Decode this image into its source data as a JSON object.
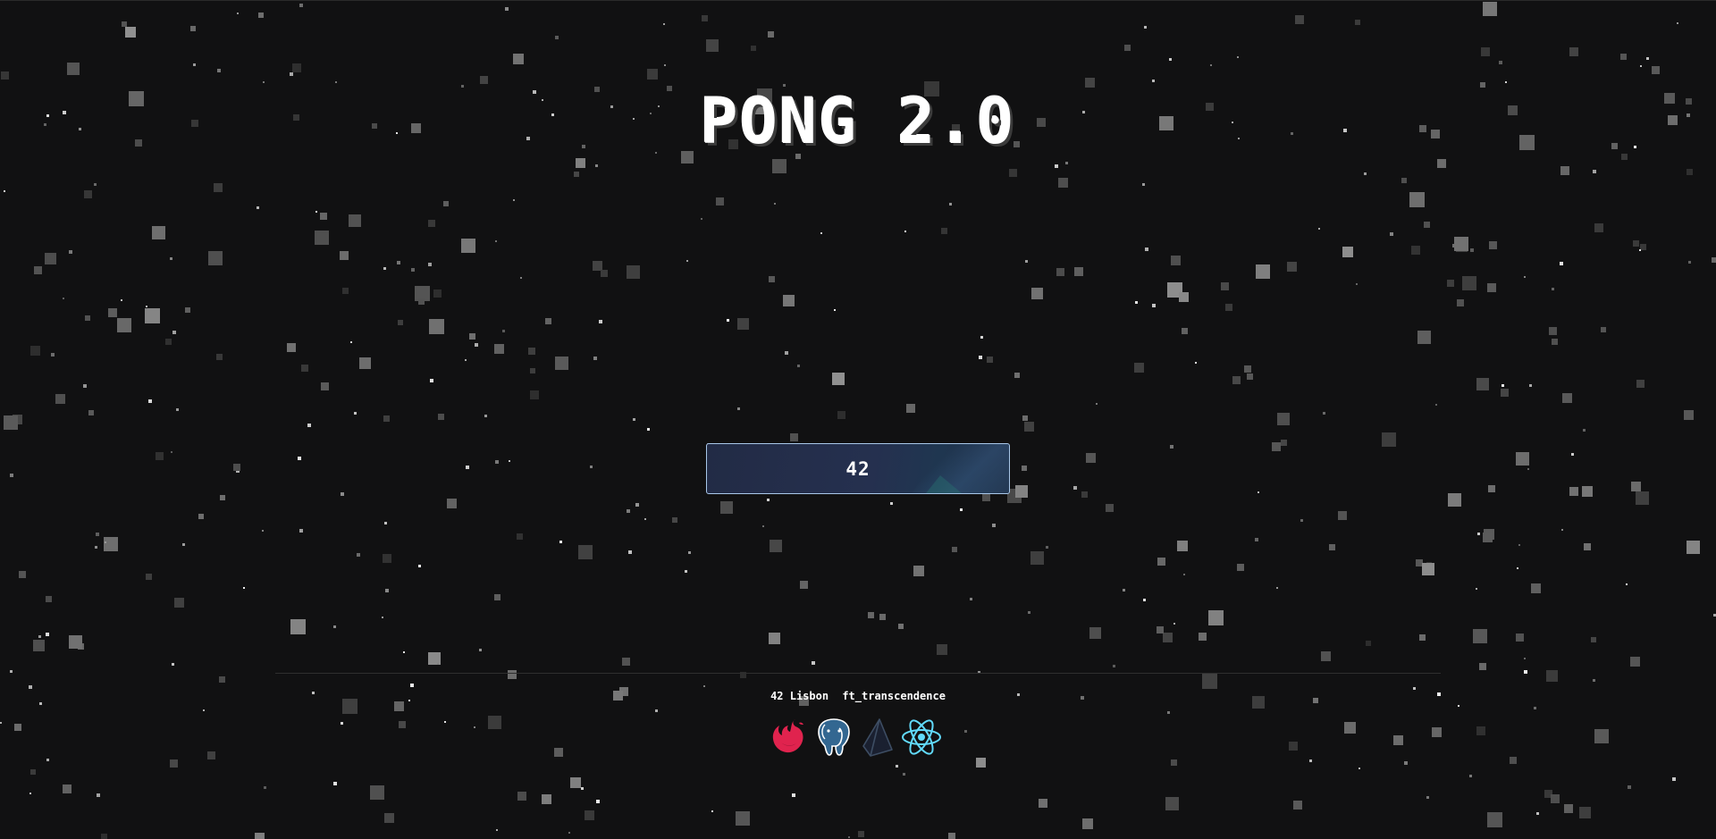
{
  "app": {
    "title": "PONG 2.0"
  },
  "login": {
    "button_label": "42"
  },
  "footer": {
    "school": "42 Lisbon",
    "project": "ft_transcendence",
    "logos": [
      "nestjs-icon",
      "postgresql-icon",
      "prisma-icon",
      "react-icon"
    ]
  },
  "colors": {
    "background": "#111112",
    "button_border": "#a9c8ea",
    "button_bg": "#232c48",
    "nestjs": "#e0234e",
    "postgres": "#336791",
    "prisma": "#2d3748",
    "react": "#61dafb"
  }
}
